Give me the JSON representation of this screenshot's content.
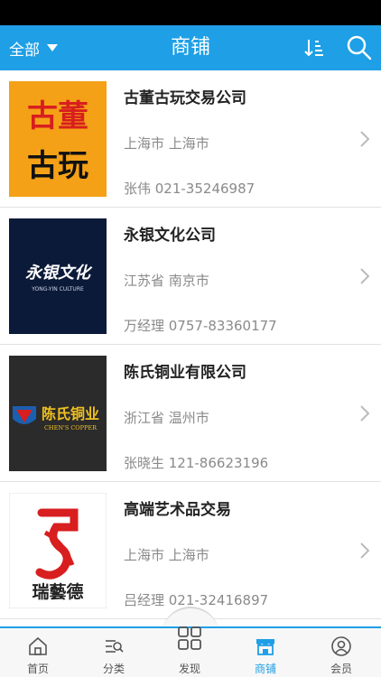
{
  "header": {
    "filter_label": "全部",
    "title": "商铺"
  },
  "shops": [
    {
      "name": "古董古玩交易公司",
      "region": "上海市 上海市",
      "contact": "张伟 021-35246987",
      "logo_text": [
        "古董",
        "古玩"
      ]
    },
    {
      "name": "永银文化公司",
      "region": "江苏省 南京市",
      "contact": "万经理 0757-83360177",
      "logo_text": [
        "永银文化",
        "YONG-YIN CULTURE"
      ]
    },
    {
      "name": "陈氏铜业有限公司",
      "region": "浙江省 温州市",
      "contact": "张晓生 121-86623196",
      "logo_text": [
        "陈氏铜业",
        "CHEN'S COPPER"
      ]
    },
    {
      "name": "高端艺术品交易",
      "region": "上海市 上海市",
      "contact": "吕经理 021-32416897",
      "logo_text": [
        "瑞藝德"
      ]
    }
  ],
  "tabs": [
    {
      "label": "首页",
      "icon": "home-icon"
    },
    {
      "label": "分类",
      "icon": "category-icon"
    },
    {
      "label": "发现",
      "icon": "discover-icon"
    },
    {
      "label": "商铺",
      "icon": "shop-icon"
    },
    {
      "label": "会员",
      "icon": "member-icon"
    }
  ],
  "colors": {
    "accent": "#1e9fe6",
    "logo1_bg": "#f4a118",
    "logo2_bg": "#0c1a3a",
    "logo3_bg": "#2b2b2b"
  }
}
